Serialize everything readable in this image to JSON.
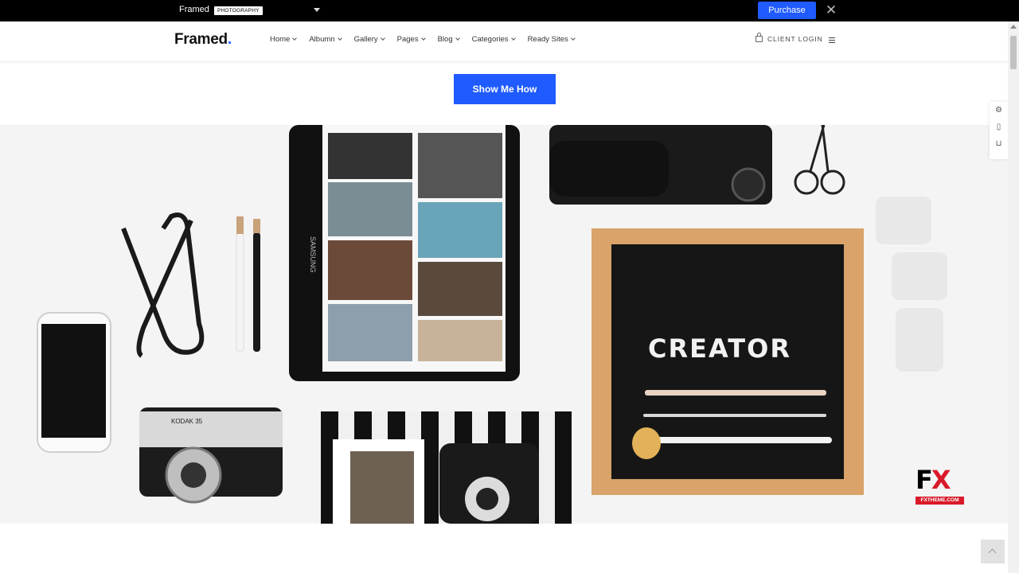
{
  "topbar": {
    "title": "Framed",
    "badge": "PHOTOGRAPHY",
    "purchase_label": "Purchase",
    "close_glyph": "✕"
  },
  "header": {
    "logo_text": "Framed",
    "logo_dot": ".",
    "nav": [
      {
        "label": "Home"
      },
      {
        "label": "Albumn"
      },
      {
        "label": "Gallery"
      },
      {
        "label": "Pages"
      },
      {
        "label": "Blog"
      },
      {
        "label": "Categories"
      },
      {
        "label": "Ready Sites"
      }
    ],
    "client_login": "CLIENT LOGIN"
  },
  "cta": {
    "label": "Show Me How"
  },
  "hero": {
    "letterboard_text": "CREATOR",
    "tablet_brand": "SAMSUNG",
    "camera_brand": "KODAK 35"
  },
  "watermark": {
    "big_f": "F",
    "big_x": "X",
    "small": "FXTHEME.COM"
  },
  "colors": {
    "accent": "#1f5bff",
    "topbar": "#000000",
    "fx_red": "#d91a2a"
  }
}
